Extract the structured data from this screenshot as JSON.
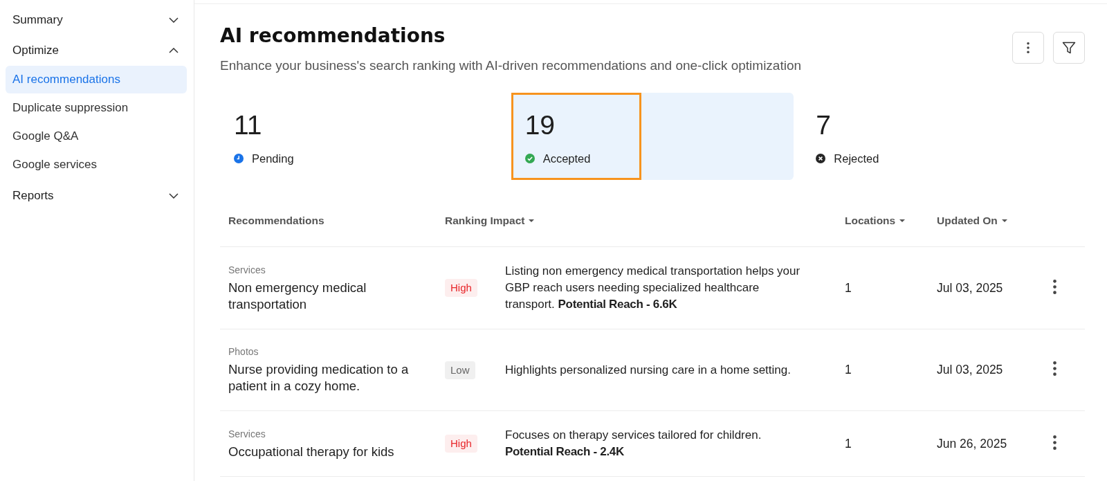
{
  "sidebar": {
    "sections": [
      {
        "label": "Summary",
        "expanded": false
      },
      {
        "label": "Optimize",
        "expanded": true,
        "items": [
          {
            "label": "AI recommendations",
            "selected": true
          },
          {
            "label": "Duplicate suppression",
            "selected": false
          },
          {
            "label": "Google Q&A",
            "selected": false
          },
          {
            "label": "Google services",
            "selected": false
          }
        ]
      },
      {
        "label": "Reports",
        "expanded": false
      }
    ]
  },
  "header": {
    "title": "AI recommendations",
    "subtitle": "Enhance your business's search ranking with AI-driven recommendations and one-click optimization"
  },
  "stats": [
    {
      "kind": "pending",
      "count": "11",
      "label": "Pending",
      "selected": false,
      "outlined": false
    },
    {
      "kind": "accepted",
      "count": "19",
      "label": "Accepted",
      "selected": true,
      "outlined": true
    },
    {
      "kind": "rejected",
      "count": "7",
      "label": "Rejected",
      "selected": false,
      "outlined": false
    }
  ],
  "table": {
    "columns": [
      {
        "label": "Recommendations",
        "sortable": false
      },
      {
        "label": "Ranking Impact",
        "sortable": true
      },
      {
        "label": "Locations",
        "sortable": true
      },
      {
        "label": "Updated On",
        "sortable": true
      }
    ],
    "rows": [
      {
        "category": "Services",
        "title": "Non emergency medical transportation",
        "impact": {
          "kind": "high",
          "label": "High"
        },
        "description": "Listing non emergency medical transportation helps your GBP reach users needing specialized healthcare transport. **Potential Reach - 6.6K**",
        "locations": "1",
        "updated_on": "Jul 03, 2025"
      },
      {
        "category": "Photos",
        "title": "Nurse providing medication to a patient in a cozy home.",
        "impact": {
          "kind": "low",
          "label": "Low"
        },
        "description": "Highlights personalized nursing care in a home setting.",
        "locations": "1",
        "updated_on": "Jul 03, 2025"
      },
      {
        "category": "Services",
        "title": "Occupational therapy for kids",
        "impact": {
          "kind": "high",
          "label": "High"
        },
        "description": "Focuses on therapy services tailored for children. **Potential Reach - 2.4K**",
        "locations": "1",
        "updated_on": "Jun 26, 2025"
      }
    ]
  }
}
